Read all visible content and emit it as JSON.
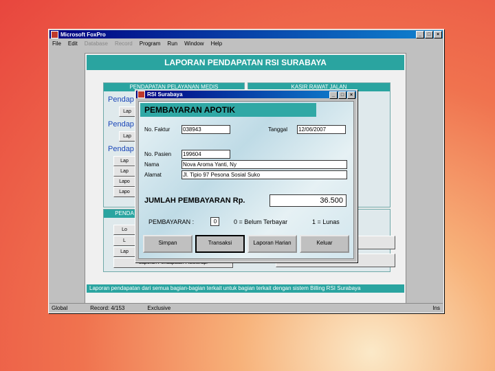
{
  "app": {
    "title": "Microsoft FoxPro",
    "menu": [
      "File",
      "Edit",
      "Database",
      "Record",
      "Program",
      "Run",
      "Window",
      "Help"
    ],
    "status": [
      "Global",
      "Record: 4/153",
      "Exclusive",
      "Ins"
    ]
  },
  "report": {
    "title": "LAPORAN PENDAPATAN RSI SURABAYA",
    "panel_left_title": "PENDAPATAN PELAYANAN MEDIS",
    "panel_right_title": "KASIR RAWAT JALAN",
    "panel_left2_title": "PENDA",
    "blue_labels": [
      "Pendap",
      "Pendap",
      "Pendap"
    ],
    "left_buttons": [
      "Lap",
      "Lap",
      "Lap",
      "Lap",
      "Lapo",
      "Lapo",
      "Lo",
      "L",
      "Lap",
      "Lo"
    ],
    "bottom_button": "Laporan Pendapatan Fisioterapi",
    "footer": "Laporan pendapatan dari semua bagian-bagian terkait untuk bagian terkait dengan sistem Billing RSI Surabaya"
  },
  "dialog": {
    "title": "RSI Surabaya",
    "heading": "PEMBAYARAN APOTIK",
    "faktur_label": "No. Faktur",
    "faktur_value": "038943",
    "tanggal_label": "Tanggal",
    "tanggal_value": "12/06/2007",
    "pasien_label": "No. Pasien",
    "pasien_value": "199604",
    "nama_label": "Nama",
    "nama_value": "Nova Aroma Yanti, Ny",
    "alamat_label": "Alamat",
    "alamat_value": "Jl. Tipio 97 Pesona Sosial Suko",
    "total_label": "JUMLAH PEMBAYARAN Rp.",
    "total_value": "36.500",
    "pembayaran_label": "PEMBAYARAN :",
    "pembayaran_value": "0",
    "legend0": "0 = Belum Terbayar",
    "legend1": "1 = Lunas",
    "buttons": [
      "Simpan",
      "Transaksi",
      "Laporan Harian",
      "Keluar"
    ]
  }
}
